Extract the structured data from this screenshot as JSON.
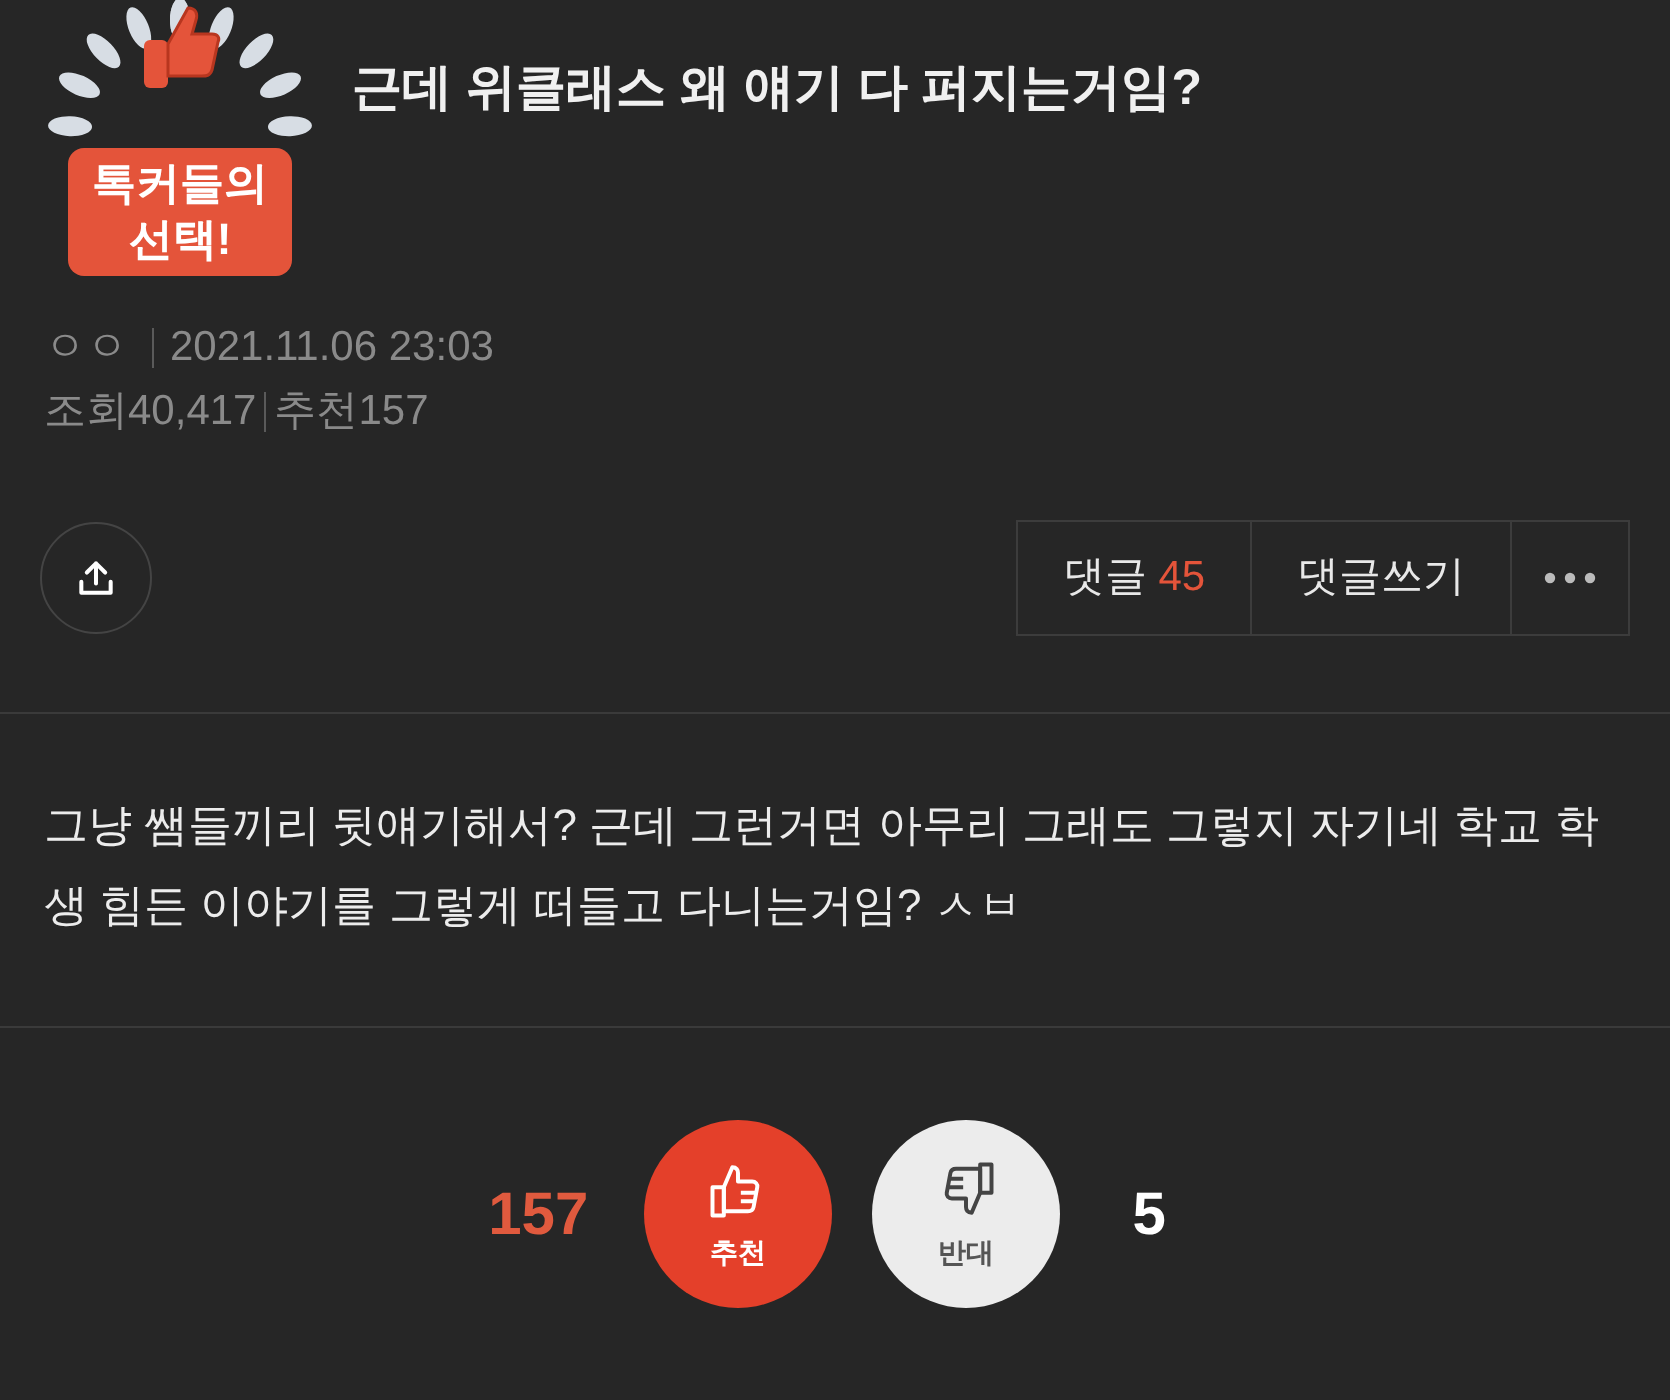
{
  "badge": {
    "label": "톡커들의\n선택!"
  },
  "title": "근데 위클래스 왜 얘기 다 퍼지는거임?",
  "meta": {
    "author": "ㅇㅇ",
    "date": "2021.11.06 23:03",
    "views_label": "조회",
    "views": "40,417",
    "recommend_label": "추천",
    "recommend": "157"
  },
  "actions": {
    "comments_label": "댓글",
    "comments_count": "45",
    "write_comment": "댓글쓰기"
  },
  "body": "그냥 쌤들끼리 뒷얘기해서? 근데 그런거면 아무리 그래도 그렇지 자기네 학교 학생 힘든 이야기를 그렇게 떠들고 다니는거임? ㅅㅂ",
  "votes": [
    {
      "kind": "up",
      "count": "157",
      "label": "추천"
    },
    {
      "kind": "down",
      "label": "반대",
      "count": "5"
    }
  ]
}
